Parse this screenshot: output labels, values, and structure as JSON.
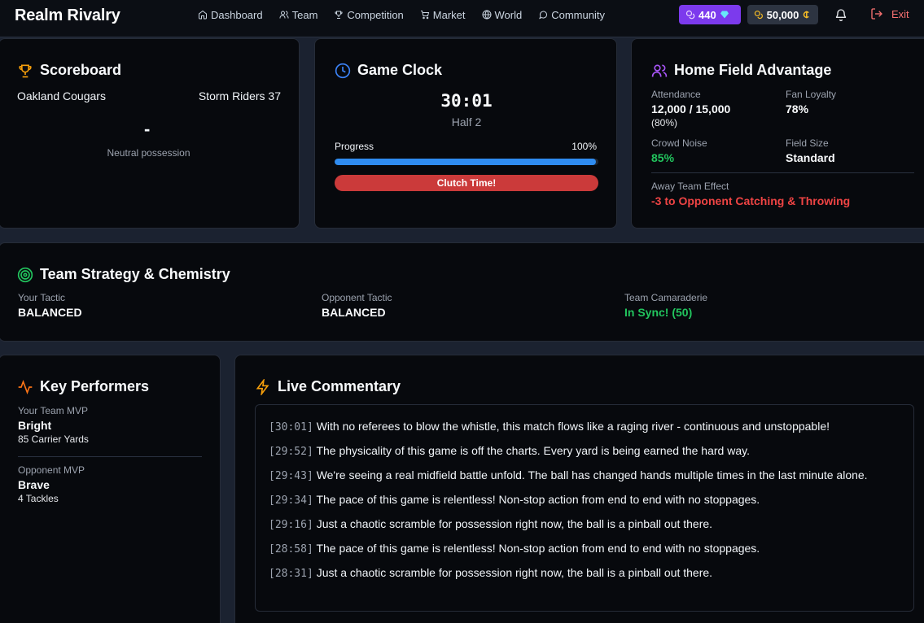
{
  "app": {
    "title": "Realm Rivalry"
  },
  "nav": {
    "links": [
      {
        "label": "Dashboard",
        "icon": "home-icon"
      },
      {
        "label": "Team",
        "icon": "users-icon"
      },
      {
        "label": "Competition",
        "icon": "trophy-icon"
      },
      {
        "label": "Market",
        "icon": "cart-icon"
      },
      {
        "label": "World",
        "icon": "globe-icon"
      },
      {
        "label": "Community",
        "icon": "chat-icon"
      }
    ],
    "gems": "440",
    "credits": "50,000",
    "exit_label": "Exit"
  },
  "scoreboard": {
    "title": "Scoreboard",
    "home_team": "Oakland Cougars",
    "away_team": "Storm Riders 37",
    "score_separator": "-",
    "possession": "Neutral possession"
  },
  "clock": {
    "title": "Game Clock",
    "time": "30:01",
    "half": "Half 2",
    "progress_label": "Progress",
    "progress_text": "100%",
    "progress_value": 0.99,
    "clutch_label": "Clutch Time!"
  },
  "home_field": {
    "title": "Home Field Advantage",
    "attendance_label": "Attendance",
    "attendance_value": "12,000 / 15,000",
    "attendance_pct": "(80%)",
    "fan_loyalty_label": "Fan Loyalty",
    "fan_loyalty_value": "78%",
    "crowd_noise_label": "Crowd Noise",
    "crowd_noise_value": "85%",
    "field_size_label": "Field Size",
    "field_size_value": "Standard",
    "away_effect_label": "Away Team Effect",
    "away_effect_value": "-3 to Opponent Catching & Throwing"
  },
  "strategy": {
    "title": "Team Strategy & Chemistry",
    "your_tactic_label": "Your Tactic",
    "your_tactic_value": "BALANCED",
    "opp_tactic_label": "Opponent Tactic",
    "opp_tactic_value": "BALANCED",
    "camaraderie_label": "Team Camaraderie",
    "camaraderie_value": "In Sync! (50)"
  },
  "performers": {
    "title": "Key Performers",
    "your_mvp_label": "Your Team MVP",
    "your_mvp_name": "Bright",
    "your_mvp_stat": "85 Carrier Yards",
    "opp_mvp_label": "Opponent MVP",
    "opp_mvp_name": "Brave",
    "opp_mvp_stat": "4 Tackles"
  },
  "commentary": {
    "title": "Live Commentary",
    "entries": [
      {
        "time": "[30:01]",
        "text": "With no referees to blow the whistle, this match flows like a raging river - continuous and unstoppable!"
      },
      {
        "time": "[29:52]",
        "text": "The physicality of this game is off the charts. Every yard is being earned the hard way."
      },
      {
        "time": "[29:43]",
        "text": "We're seeing a real midfield battle unfold. The ball has changed hands multiple times in the last minute alone."
      },
      {
        "time": "[29:34]",
        "text": "The pace of this game is relentless! Non-stop action from end to end with no stoppages."
      },
      {
        "time": "[29:16]",
        "text": "Just a chaotic scramble for possession right now, the ball is a pinball out there."
      },
      {
        "time": "[28:58]",
        "text": "The pace of this game is relentless! Non-stop action from end to end with no stoppages."
      },
      {
        "time": "[28:31]",
        "text": "Just a chaotic scramble for possession right now, the ball is a pinball out there."
      }
    ]
  },
  "colors": {
    "accent_blue": "#2f8cf0",
    "danger_red": "#ef4444",
    "success_green": "#22c55e",
    "gem_purple": "#7c3aed",
    "trophy_gold": "#f59e0b"
  }
}
